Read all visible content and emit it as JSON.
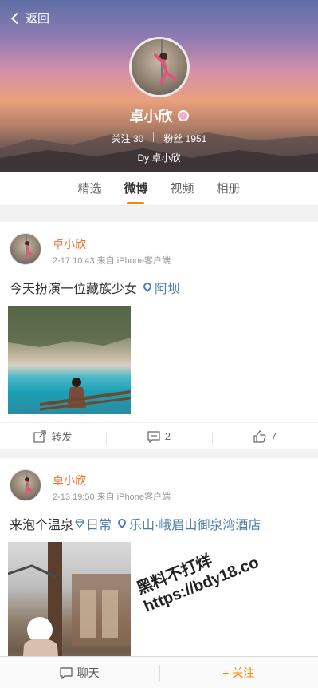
{
  "header": {
    "back_label": "返回",
    "name": "卓小欣",
    "badge": "✓",
    "following": "关注 30",
    "followers": "粉丝 1951",
    "description": "Dy 卓小欣"
  },
  "tabs": [
    {
      "label": "精选",
      "active": false
    },
    {
      "label": "微博",
      "active": true
    },
    {
      "label": "视频",
      "active": false
    },
    {
      "label": "相册",
      "active": false
    }
  ],
  "posts": [
    {
      "username": "卓小欣",
      "meta": "2-17 10:43 来自 iPhone客户端",
      "text": "今天扮演一位藏族少女",
      "location": "阿坝",
      "repost_label": "转发",
      "comments": "2",
      "likes": "7"
    },
    {
      "username": "卓小欣",
      "meta": "2-13 19:50 来自 iPhone客户端",
      "text": "来泡个温泉",
      "tag": "日常",
      "location": "乐山·峨眉山御泉湾酒店"
    }
  ],
  "bottombar": {
    "chat_label": "聊天",
    "follow_label": "+ 关注"
  },
  "watermark": {
    "line1": "黑料不打烊",
    "line2": "https://bdy18.co"
  },
  "colors": {
    "accent": "#ff8200",
    "username": "#f86d34",
    "link": "#507daf"
  }
}
